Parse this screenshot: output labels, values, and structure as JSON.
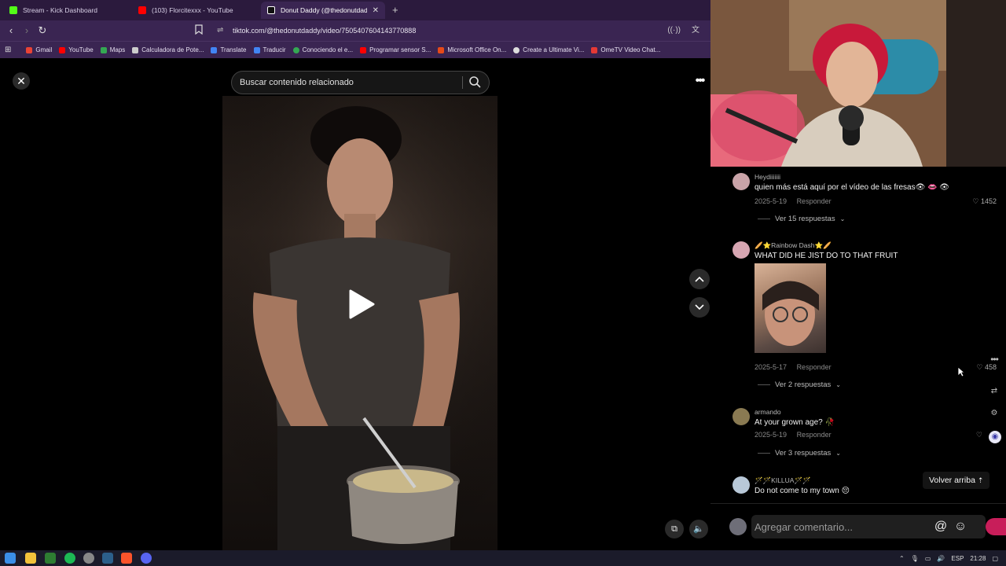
{
  "browser": {
    "tabs": [
      {
        "title": "Stream - Kick Dashboard",
        "icon": "kick-icon",
        "color": "#53fc18"
      },
      {
        "title": "(103) Florcitexxx - YouTube",
        "icon": "youtube-icon",
        "color": "#ff0000"
      },
      {
        "title": "Donut Daddy (@thedonutdaddy",
        "icon": "tiktok-icon",
        "color": "#ffffff"
      }
    ],
    "url": "tiktok.com/@thedonutdaddy/video/7505407604143770888",
    "bookmarks": [
      {
        "label": "Gmail",
        "color": "#ea4335"
      },
      {
        "label": "YouTube",
        "color": "#ff0000"
      },
      {
        "label": "Maps",
        "color": "#34a853"
      },
      {
        "label": "Calculadora de Pote...",
        "color": "#cccccc"
      },
      {
        "label": "Translate",
        "color": "#4285f4"
      },
      {
        "label": "Traducir",
        "color": "#4285f4"
      },
      {
        "label": "Conociendo el e...",
        "color": "#34a853"
      },
      {
        "label": "Programar sensor S...",
        "color": "#ff0000"
      },
      {
        "label": "Microsoft Office On...",
        "color": "#e64a19"
      },
      {
        "label": "Create a Ultimate Vi...",
        "color": "#dddddd"
      },
      {
        "label": "OmeTV Video Chat...",
        "color": "#e53935"
      }
    ]
  },
  "tiktok": {
    "search_placeholder": "Buscar contenido relacionado",
    "volver_arriba": "Volver arriba",
    "comment_placeholder": "Agregar comentario..."
  },
  "comments": [
    {
      "user": "Heydiiiiiii",
      "text": "quien más está aquí por el vídeo de las fresas👁 👄 👁",
      "date": "2025-5-19",
      "reply": "Responder",
      "likes": "1452",
      "replies": "Ver 15 respuestas",
      "avatar_color": "#c9a3a8"
    },
    {
      "user": "🥖⭐Rainbow Dash⭐🥖",
      "text": "WHAT DID HE JIST DO TO THAT FRUIT",
      "date": "2025-5-17",
      "reply": "Responder",
      "likes": "458",
      "replies": "Ver 2 respuestas",
      "avatar_color": "#d7a6b2"
    },
    {
      "user": "armando",
      "text": "At your grown age? 🥀",
      "date": "2025-5-19",
      "reply": "Responder",
      "likes": "",
      "replies": "Ver 3 respuestas",
      "avatar_color": "#8a7a52"
    },
    {
      "user": "🪄🪄KILLUA🪄🪄",
      "text": "Do not come to my town 😔",
      "date": "",
      "reply": "",
      "likes": "",
      "replies": "",
      "avatar_color": "#b8c8d8"
    }
  ],
  "taskbar": {
    "lang": "ESP",
    "time": "21:28"
  }
}
